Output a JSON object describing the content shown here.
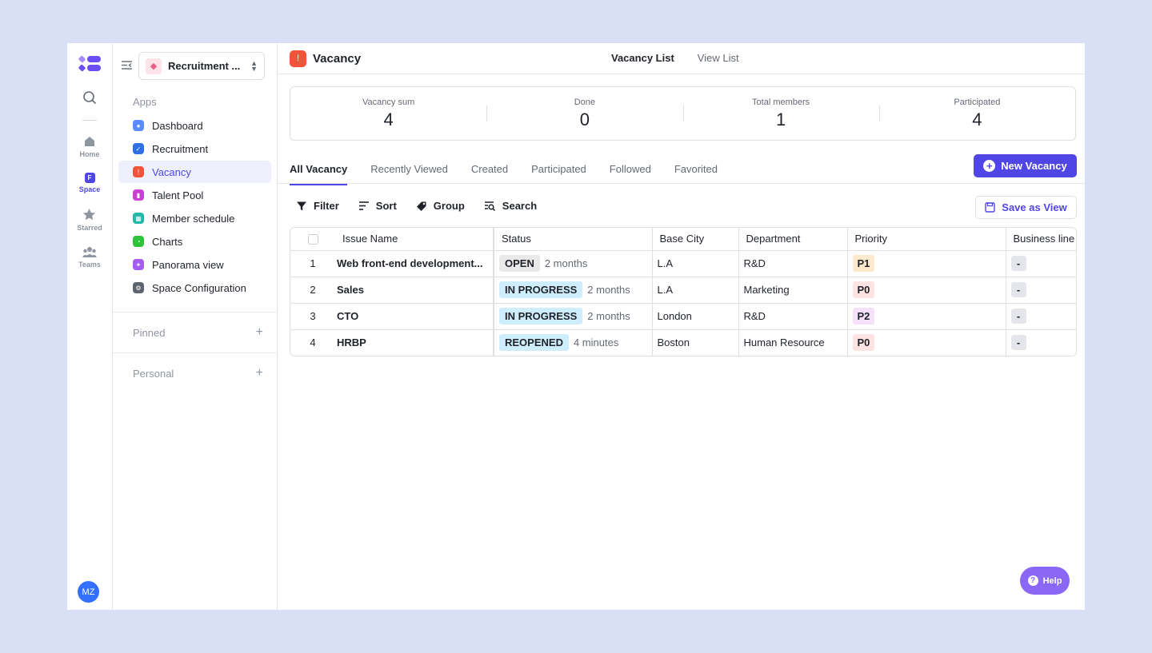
{
  "rail": {
    "items": [
      {
        "label": "Home"
      },
      {
        "label": "Space"
      },
      {
        "label": "Starred"
      },
      {
        "label": "Teams"
      }
    ],
    "avatar": "MZ",
    "space_icon_letter": "F"
  },
  "sidebar": {
    "space_name": "Recruitment ...",
    "apps_title": "Apps",
    "items": [
      {
        "label": "Dashboard",
        "color": "#5b8cff"
      },
      {
        "label": "Recruitment",
        "color": "#2f6fe4"
      },
      {
        "label": "Vacancy",
        "color": "#f0553b"
      },
      {
        "label": "Talent Pool",
        "color": "#c93fd1"
      },
      {
        "label": "Member schedule",
        "color": "#22b8a7"
      },
      {
        "label": "Charts",
        "color": "#2ec43a"
      },
      {
        "label": "Panorama view",
        "color": "#a75cf0"
      },
      {
        "label": "Space Configuration",
        "color": "#5c6470"
      }
    ],
    "pinned": "Pinned",
    "personal": "Personal"
  },
  "header": {
    "title": "Vacancy",
    "tabs": [
      "Vacancy List",
      "View List"
    ]
  },
  "stats": [
    {
      "label": "Vacancy sum",
      "value": "4"
    },
    {
      "label": "Done",
      "value": "0"
    },
    {
      "label": "Total members",
      "value": "1"
    },
    {
      "label": "Participated",
      "value": "4"
    }
  ],
  "tabs": [
    "All Vacancy",
    "Recently Viewed",
    "Created",
    "Participated",
    "Followed",
    "Favorited"
  ],
  "new_button": "New Vacancy",
  "toolbar": {
    "filter": "Filter",
    "sort": "Sort",
    "group": "Group",
    "search": "Search",
    "save_view": "Save as View"
  },
  "table": {
    "columns": [
      "Issue Name",
      "Status",
      "Base City",
      "Department",
      "Priority",
      "Business line"
    ],
    "rows": [
      {
        "idx": "1",
        "name": "Web front-end development...",
        "status": "OPEN",
        "age": "2 months",
        "city": "L.A",
        "dept": "R&D",
        "priority": "P1",
        "business": "-"
      },
      {
        "idx": "2",
        "name": "Sales",
        "status": "IN PROGRESS",
        "age": "2 months",
        "city": "L.A",
        "dept": "Marketing",
        "priority": "P0",
        "business": "-"
      },
      {
        "idx": "3",
        "name": "CTO",
        "status": "IN PROGRESS",
        "age": "2 months",
        "city": "London",
        "dept": "R&D",
        "priority": "P2",
        "business": "-"
      },
      {
        "idx": "4",
        "name": "HRBP",
        "status": "REOPENED",
        "age": "4 minutes",
        "city": "Boston",
        "dept": "Human Resource",
        "priority": "P0",
        "business": "-"
      }
    ]
  },
  "help": "Help",
  "colors": {
    "accent": "#4f46e5",
    "help": "#8b67f6",
    "vacancy": "#f0553b"
  }
}
